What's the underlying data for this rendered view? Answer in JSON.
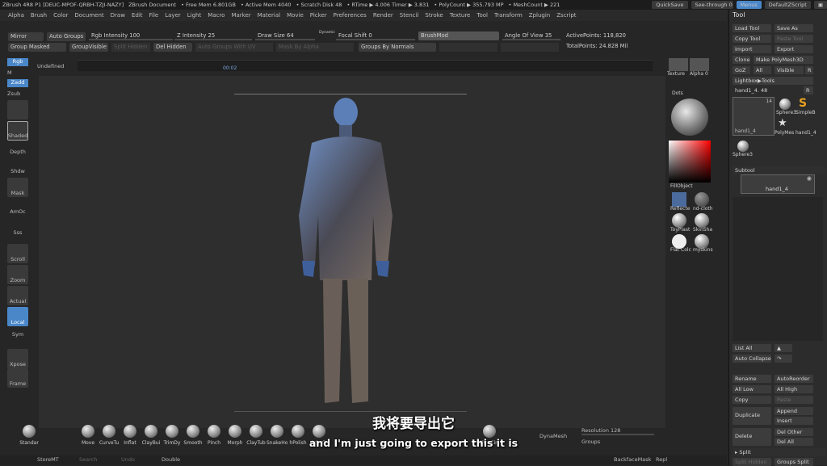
{
  "titlebar": {
    "items": [
      "ZBrush 4R8 P1 [DEUC-MPOF-QRBH-TZJI-NAZY]",
      "ZBrush Document",
      "• Free Mem 6.801GB",
      "• Active Mem 4040",
      "• Scratch Disk 48",
      "• RTime ▶ 4.006 Timer ▶ 3.831",
      "• PolyCount ▶ 355.793 MP",
      "• MeshCount ▶ 221"
    ],
    "quicksave": "QuickSave",
    "seethrough": "See-through  0",
    "menus": "Menus",
    "script": "DefaultZScript"
  },
  "menubar": [
    "Alpha",
    "Brush",
    "Color",
    "Document",
    "Draw",
    "Edit",
    "File",
    "Layer",
    "Light",
    "Macro",
    "Marker",
    "Material",
    "Movie",
    "Picker",
    "Preferences",
    "Render",
    "Stencil",
    "Stroke",
    "Texture",
    "Tool",
    "Transform",
    "Zplugin",
    "Zscript"
  ],
  "topshelf": {
    "mirror": "Mirror",
    "auto_groups": "Auto Groups",
    "rgb_intensity": "Rgb Intensity 100",
    "z_intensity": "Z Intensity 25",
    "draw_size": "Draw Size 64",
    "dynamic": "Dynamic",
    "focal_shift": "Focal Shift 0",
    "brush_mod": "BrushMod",
    "angle_of_view": "Angle Of View 35",
    "active_points": "ActivePoints: 118,820",
    "group_masked": "Group Masked",
    "group_visible": "GroupVisible",
    "split_hidden": "Split Hidden",
    "del_hidden": "Del Hidden",
    "auto_groups_with_uv": "Auto Groups With UV",
    "mask_by_alpha": "Mask By Alpha",
    "groups_by_normals": "Groups By Normals",
    "total_points": "TotalPoints: 24.828 Mil"
  },
  "timeline": {
    "marker": "00:02"
  },
  "leftbar": {
    "rgb": "Rgb",
    "undefined_label": "Undefined",
    "m": "M",
    "zadd": "Zadd",
    "zsub": "Zsub",
    "shaded": "Shaded",
    "depth": "Depth",
    "shdw": "Shdw",
    "mask": "Mask",
    "amoc": "AmOc",
    "sss": "Sss",
    "scroll": "Scroll",
    "zoom": "Zoom",
    "actual": "Actual",
    "local": "Local",
    "sym": "Sym",
    "xpose": "Xpose",
    "frame": "Frame"
  },
  "rightpalette": {
    "texture": "Texture",
    "alpha": "Alpha 0",
    "dots": "Dots",
    "fill_object": "FillObject",
    "materials": [
      "Reflecte",
      "nd-cloth",
      "ToyPlast",
      "SkinSha",
      "Flat Colc",
      "myskins"
    ]
  },
  "toolpanel": {
    "title": "Tool",
    "load_tool": "Load Tool",
    "save_as": "Save As",
    "copy_tool": "Copy Tool",
    "paste_tool": "Paste Tool",
    "import": "Import",
    "export": "Export",
    "clone": "Clone",
    "make_polymesh": "Make PolyMesh3D",
    "goz": "GoZ",
    "all": "All",
    "visible": "Visible",
    "r": "R",
    "lightbox_tools": "Lightbox▶Tools",
    "current_tool": "hand1_4. 48",
    "thumb_count": "14",
    "thumbs": [
      "hand1_4",
      "Sphere3",
      "SimpleB",
      "PolyMes",
      "hand1_4",
      "Sphere3"
    ],
    "subtool": "Subtool",
    "subtool_item": "hand1_4",
    "list_all": "List All",
    "auto_collapse": "Auto Collapse",
    "rename": "Rename",
    "auto_reorder": "AutoReorder",
    "all_low": "All Low",
    "all_high": "All High",
    "copy": "Copy",
    "paste": "Paste",
    "duplicate": "Duplicate",
    "append": "Append",
    "insert": "Insert",
    "delete": "Delete",
    "del_other": "Del Other",
    "del_all": "Del All",
    "split": "▸ Split",
    "split_hidden": "Split Hidden",
    "groups_split": "Groups Split"
  },
  "bottomshelf": {
    "brushes": [
      "Standar",
      "Move",
      "CurveTu",
      "Inflat",
      "ClayBui",
      "TrimDy",
      "Smooth",
      "Pinch",
      "Morph",
      "ClayTub",
      "SnakeHo",
      "hPolish",
      "Orb_Cr",
      "Flat",
      "Claytub",
      "SliceCirc"
    ],
    "dynamesh": "DynaMesh",
    "resolution": "Resolution 128",
    "groups": "Groups"
  },
  "statusbar": {
    "storemt": "StoreMT",
    "search": "Search",
    "undo": "Undo",
    "double": "Double",
    "backface": "BackfaceMask",
    "repl": "Repl"
  },
  "subtitles": {
    "cn": "我将要导出它",
    "en": "and I'm just going to export this it is"
  },
  "colors": {
    "accent": "#4a87c9",
    "bg": "#262626"
  }
}
